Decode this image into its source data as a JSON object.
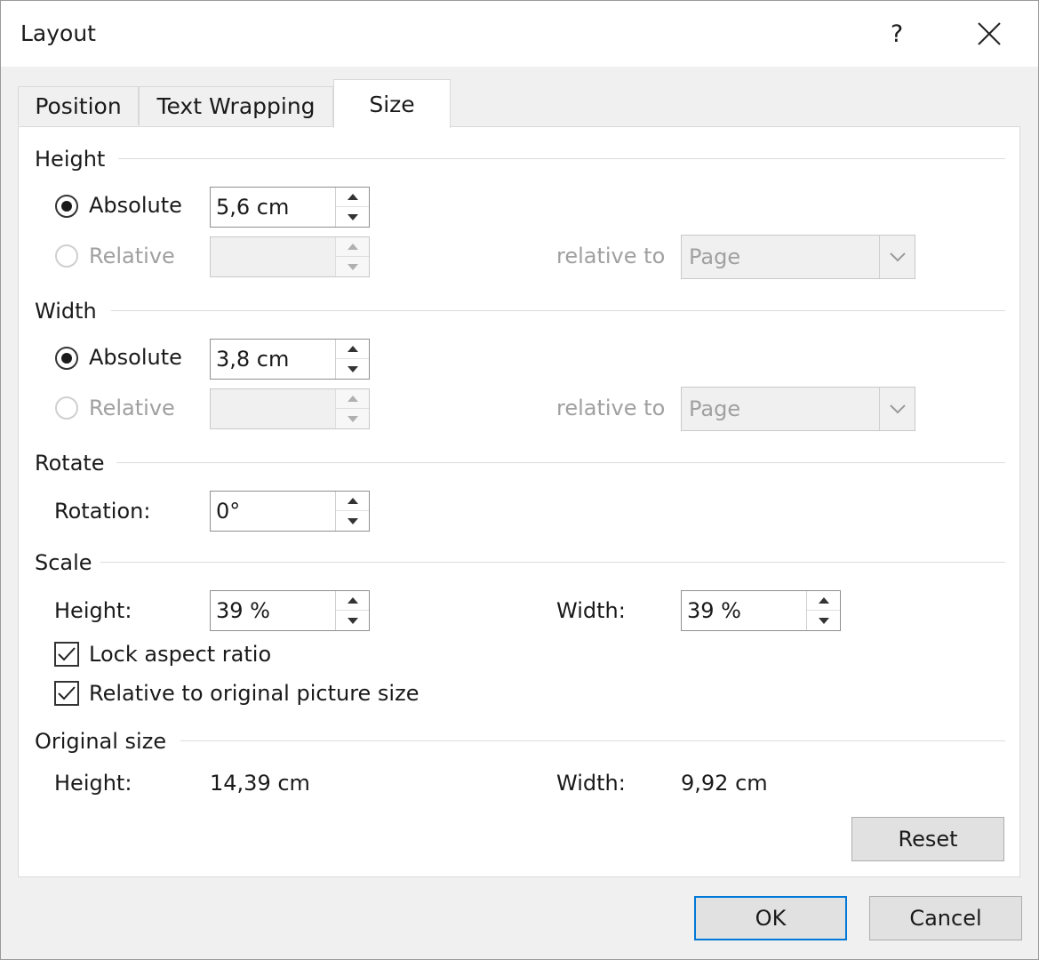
{
  "dialog": {
    "title": "Layout",
    "help": "?"
  },
  "tabs": [
    {
      "label": "Position"
    },
    {
      "label": "Text Wrapping"
    },
    {
      "label": "Size"
    }
  ],
  "height": {
    "section": "Height",
    "absolute_label": "Absolute",
    "absolute_value": "5,6 cm",
    "relative_label": "Relative",
    "relative_value": "",
    "relative_to_label": "relative to",
    "relative_to_value": "Page"
  },
  "width": {
    "section": "Width",
    "absolute_label": "Absolute",
    "absolute_value": "3,8 cm",
    "relative_label": "Relative",
    "relative_value": "",
    "relative_to_label": "relative to",
    "relative_to_value": "Page"
  },
  "rotate": {
    "section": "Rotate",
    "rotation_label": "Rotation:",
    "rotation_value": "0°"
  },
  "scale": {
    "section": "Scale",
    "height_label": "Height:",
    "height_value": "39 %",
    "width_label": "Width:",
    "width_value": "39 %",
    "lock_label": "Lock aspect ratio",
    "relative_label": "Relative to original picture size"
  },
  "original": {
    "section": "Original size",
    "height_label": "Height:",
    "height_value": "14,39 cm",
    "width_label": "Width:",
    "width_value": "9,92 cm"
  },
  "buttons": {
    "reset": "Reset",
    "ok": "OK",
    "cancel": "Cancel"
  }
}
